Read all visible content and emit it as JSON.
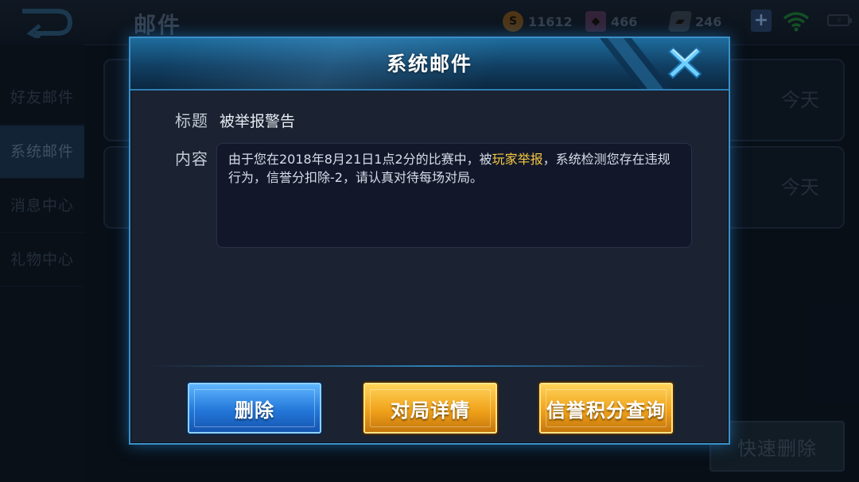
{
  "topbar": {
    "page_title": "邮件",
    "gold_count": "11612",
    "diamond_count": "466",
    "voucher_count": "246",
    "plus_label": "+"
  },
  "sidebar": {
    "items": [
      {
        "label": "好友邮件"
      },
      {
        "label": "系统邮件"
      },
      {
        "label": "消息中心"
      },
      {
        "label": "礼物中心"
      }
    ]
  },
  "mail_list": {
    "cards": [
      {
        "time": "今天"
      },
      {
        "time": "今天"
      }
    ],
    "quick_delete_label": "快速删除"
  },
  "dialog": {
    "title": "系统邮件",
    "subject_label": "标题",
    "subject_value": "被举报警告",
    "content_label": "内容",
    "content_before": "由于您在2018年8月21日1点2分的比赛中，被",
    "content_highlight": "玩家举报",
    "content_after": "，系统检测您存在违规行为，信誉分扣除-2，请认真对待每场对局。",
    "highlight_color": "#f5c842",
    "buttons": {
      "delete": "删除",
      "match_details": "对局详情",
      "credit_query": "信誉积分查询"
    }
  },
  "colors": {
    "dialog_border": "#3a90c8",
    "primary_button": "#2377d9",
    "secondary_button": "#f0a21a"
  },
  "icons": [
    "back-icon",
    "gold-coin-icon",
    "diamond-icon",
    "voucher-icon",
    "add-icon",
    "wifi-icon",
    "battery-icon",
    "close-icon"
  ]
}
